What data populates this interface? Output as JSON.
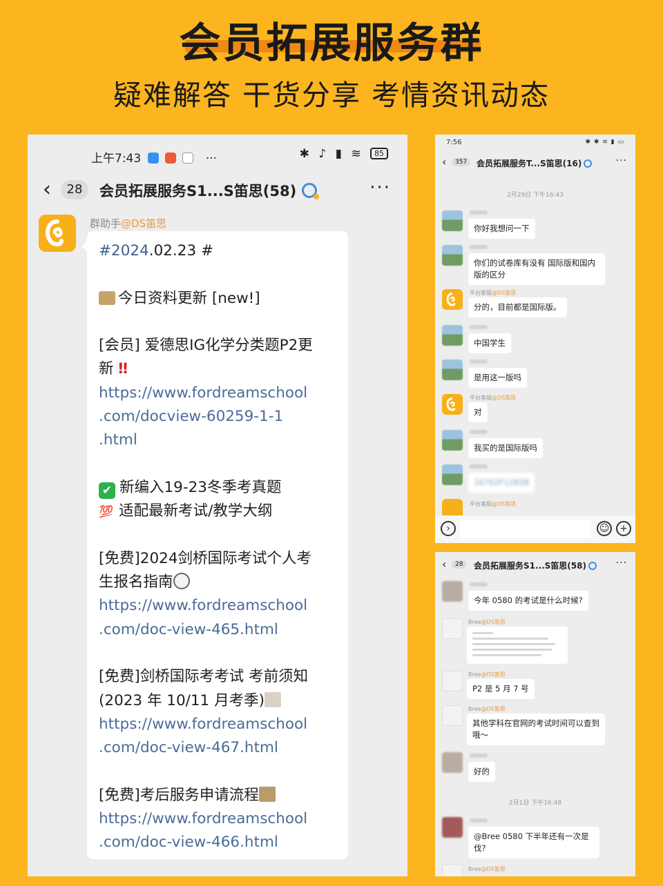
{
  "header": {
    "title": "会员拓展服务群",
    "subtitle": "疑难解答 干货分享 考情资讯动态"
  },
  "main_chat": {
    "status_time": "上午7:43",
    "status_more": "···",
    "battery": "85",
    "unread_count": "28",
    "title": "会员拓展服务S1...S笛思(58)",
    "more": "···",
    "sender_role": "群助手",
    "sender_at": "@DS笛思",
    "lines": {
      "hash_tag": "#2024",
      "hash_rest": ".02.23 #",
      "update_title": "今日资料更新 [new!]",
      "item1_a": "[会员] 爱德思IG化学分类题P2更",
      "item1_b": "新 ",
      "bang": "‼",
      "item1_link_a": "https://www.fordreamschool",
      "item1_link_b": ".com/docview-60259-1-1",
      "item1_link_c": ".html",
      "new_feature1": "新编入19-23冬季考真题",
      "new_feature2": "适配最新考试/教学大纲",
      "hundred": "💯",
      "check": "✔",
      "item2_a": "[免费]2024剑桥国际考试个人考",
      "item2_b": "生报名指南",
      "item2_link_a": "https://www.fordreamschool",
      "item2_link_b": ".com/doc-view-465.html",
      "item3_a": "[免费]剑桥国际考考试 考前须知",
      "item3_b": "(2023 年 10/11 月考季)",
      "item3_link_a": "https://www.fordreamschool",
      "item3_link_b": ".com/doc-view-467.html",
      "item4_a": "[免费]考后服务申请流程",
      "item4_link_a": "https://www.fordreamschool",
      "item4_link_b": ".com/doc-view-466.html"
    }
  },
  "rt_chat": {
    "status_time": "7:56",
    "unread_count": "357",
    "title": "会员拓展服务T...S笛思(16)",
    "more": "···",
    "date": "2月29日 下午16:43",
    "agent_role": "平台客服",
    "agent_at": "@DS笛思",
    "messages": [
      "你好我想问一下",
      "你们的试卷库有没有 国际版和国内版的区分",
      "分的，目前都是国际版。",
      "中国学生",
      "是用这一版吗",
      "对",
      "我买的是国际版吗",
      "16762F1285B"
    ],
    "emoji_icon": "☺",
    "plus_icon": "+"
  },
  "rb_chat": {
    "unread_count": "28",
    "title": "会员拓展服务S1...S笛思(58)",
    "more": "···",
    "agent_name": "Bree",
    "agent_at": "@DS笛思",
    "date": "2月1日 下午16:48",
    "messages": [
      "今年 0580 的考试是什么时候?",
      "P2 是 5 月 7 号",
      "其他学科在官网的考试时间可以查到哦～",
      "好的",
      "@Bree 0580 下半年还有一次是伐?"
    ]
  }
}
